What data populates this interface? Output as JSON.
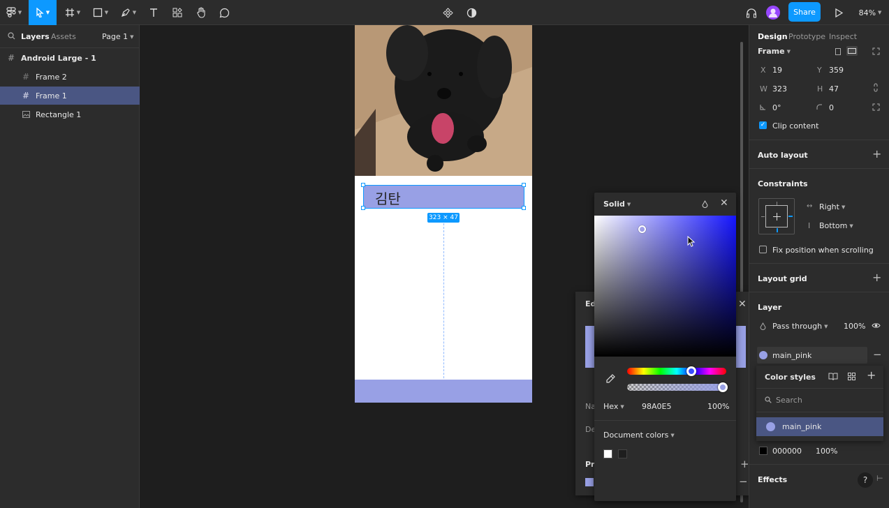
{
  "toolbar": {
    "zoom": "84%",
    "share_label": "Share"
  },
  "left_panel": {
    "tabs": [
      "Layers",
      "Assets"
    ],
    "page": "Page 1",
    "layers": [
      {
        "name": "Android Large - 1",
        "icon": "frame-icon"
      },
      {
        "name": "Frame 2",
        "icon": "frame-icon"
      },
      {
        "name": "Frame 1",
        "icon": "frame-icon",
        "selected": true
      },
      {
        "name": "Rectangle 1",
        "icon": "image-icon"
      }
    ]
  },
  "canvas": {
    "selected_text": "김탄",
    "size_badge": "323 × 47",
    "selected_fill": "#98A0E5",
    "bottom_fill": "#98A0E5"
  },
  "right_panel": {
    "tabs": [
      "Design",
      "Prototype",
      "Inspect"
    ],
    "frame_label": "Frame",
    "x": "19",
    "y": "359",
    "w": "323",
    "h": "47",
    "rotation": "0°",
    "radius": "0",
    "clip_content": "Clip content",
    "auto_layout": "Auto layout",
    "constraints": "Constraints",
    "constraint_h": "Right",
    "constraint_v": "Bottom",
    "fix_position": "Fix position when scrolling",
    "layout_grid": "Layout grid",
    "layer": "Layer",
    "blend": "Pass through",
    "opacity": "100%",
    "fill_style": "main_pink",
    "stroke_hex": "000000",
    "stroke_opacity": "100%",
    "effects": "Effects",
    "help": "?"
  },
  "color_styles": {
    "title": "Color styles",
    "search_placeholder": "Search",
    "item": "main_pink"
  },
  "picker": {
    "mode": "Solid",
    "format": "Hex",
    "hex": "98A0E5",
    "alpha": "100%",
    "document_colors": "Document colors",
    "swatches": [
      "#FFFFFF",
      "#1E1E1E"
    ]
  },
  "edit_panel": {
    "title_fragment": "Edi",
    "name_fragment": "Na",
    "desc_fragment": "De",
    "prop_fragment": "Pro"
  }
}
